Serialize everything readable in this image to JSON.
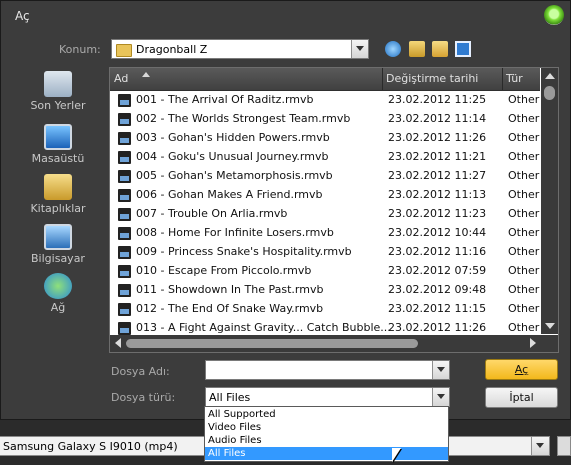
{
  "window": {
    "title": "Aç"
  },
  "location": {
    "label": "Konum:",
    "value": "Dragonball Z"
  },
  "toolbar": {
    "icons": [
      "back-icon",
      "up-folder-icon",
      "new-folder-icon",
      "view-menu-icon"
    ]
  },
  "sidebar": {
    "items": [
      {
        "label": "Son Yerler",
        "icon": "recent-places-icon"
      },
      {
        "label": "Masaüstü",
        "icon": "desktop-icon"
      },
      {
        "label": "Kitaplıklar",
        "icon": "libraries-icon"
      },
      {
        "label": "Bilgisayar",
        "icon": "computer-icon"
      },
      {
        "label": "Ağ",
        "icon": "network-icon"
      }
    ]
  },
  "filelist": {
    "columns": {
      "name": "Ad",
      "date": "Değiştirme tarihi",
      "type": "Tür"
    },
    "rows": [
      {
        "name": "001 - The Arrival Of Raditz.rmvb",
        "date": "23.02.2012 11:25",
        "type": "Other"
      },
      {
        "name": "002 - The Worlds Strongest Team.rmvb",
        "date": "23.02.2012 11:14",
        "type": "Other"
      },
      {
        "name": "003 - Gohan's Hidden Powers.rmvb",
        "date": "23.02.2012 11:26",
        "type": "Other"
      },
      {
        "name": "004 - Goku's Unusual Journey.rmvb",
        "date": "23.02.2012 11:21",
        "type": "Other"
      },
      {
        "name": "005 - Gohan's Metamorphosis.rmvb",
        "date": "23.02.2012 11:27",
        "type": "Other"
      },
      {
        "name": "006 - Gohan Makes A Friend.rmvb",
        "date": "23.02.2012 11:13",
        "type": "Other"
      },
      {
        "name": "007 - Trouble On Arlia.rmvb",
        "date": "23.02.2012 11:23",
        "type": "Other"
      },
      {
        "name": "008 - Home For Infinite Losers.rmvb",
        "date": "23.02.2012 10:44",
        "type": "Other"
      },
      {
        "name": "009 - Princess Snake's Hospitality.rmvb",
        "date": "23.02.2012 11:16",
        "type": "Other"
      },
      {
        "name": "010 - Escape From Piccolo.rmvb",
        "date": "23.02.2012 07:59",
        "type": "Other"
      },
      {
        "name": "011 - Showdown In The Past.rmvb",
        "date": "23.02.2012 09:48",
        "type": "Other"
      },
      {
        "name": "012 - The End Of Snake Way.rmvb",
        "date": "23.02.2012 11:15",
        "type": "Other"
      },
      {
        "name": "013 - A Fight Against Gravity... Catch Bubble...",
        "date": "23.02.2012 11:26",
        "type": "Other"
      }
    ]
  },
  "form": {
    "filename_label": "Dosya Adı:",
    "filename_value": "",
    "filetype_label": "Dosya türü:",
    "filetype_value": "All Files",
    "open_label": "Aç",
    "cancel_label": "İptal"
  },
  "filetype_options": [
    "All Supported",
    "Video Files",
    "Audio Files",
    "All Files"
  ],
  "filetype_selected": "All Files",
  "device_combo": {
    "value": "Samsung Galaxy S I9010 (mp4)"
  }
}
